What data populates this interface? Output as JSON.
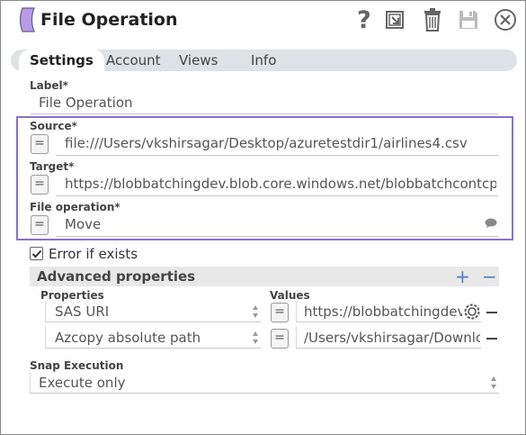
{
  "header": {
    "title": "File Operation",
    "snap_color": "#b79be6"
  },
  "tabs": [
    {
      "label": "Settings",
      "active": true
    },
    {
      "label": "Account",
      "active": false
    },
    {
      "label": "Views",
      "active": false
    },
    {
      "label": "Info",
      "active": false
    }
  ],
  "label_field": {
    "label": "Label*",
    "value": "File Operation"
  },
  "source": {
    "label": "Source*",
    "value": "file:///Users/vkshirsagar/Desktop/azuretestdir1/airlines4.csv",
    "expr": "="
  },
  "target": {
    "label": "Target*",
    "value": "https://blobbatchingdev.blob.core.windows.net/blobbatchcontcp",
    "expr": "="
  },
  "file_operation": {
    "label": "File operation*",
    "value": "Move",
    "expr": "="
  },
  "error_if_exists": {
    "label": "Error if exists",
    "checked": true
  },
  "advanced": {
    "title": "Advanced properties",
    "add": "+",
    "remove": "−",
    "col_properties": "Properties",
    "col_values": "Values",
    "rows": [
      {
        "property": "SAS URI",
        "expr": "=",
        "value": "https://blobbatchingdev.b"
      },
      {
        "property": "Azcopy absolute path",
        "expr": "=",
        "value": "/Users/vkshirsagar/Downloa"
      }
    ]
  },
  "snap_execution": {
    "label": "Snap Execution",
    "value": "Execute only"
  },
  "accent": "#8a6fd1",
  "icons": [
    "help-icon",
    "export-icon",
    "delete-icon",
    "save-icon",
    "close-icon",
    "comment-icon",
    "gear-icon"
  ]
}
